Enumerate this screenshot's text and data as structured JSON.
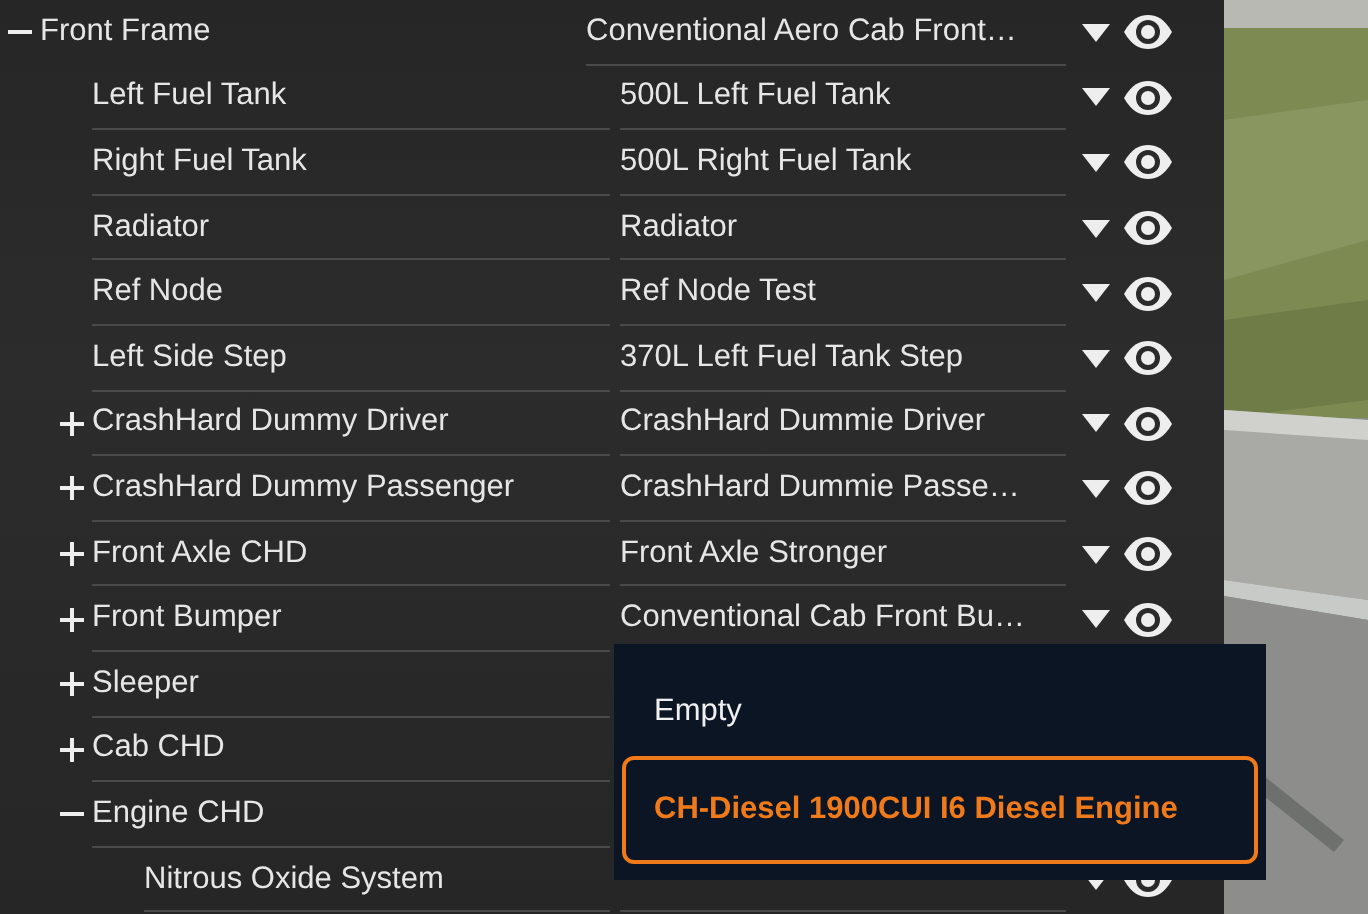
{
  "tree": [
    {
      "label": "Front Frame",
      "value": "Conventional Aero Cab Front…",
      "expanded": true,
      "children": [
        {
          "label": "Left Fuel Tank",
          "value": "500L Left Fuel Tank"
        },
        {
          "label": "Right Fuel Tank",
          "value": "500L Right Fuel Tank"
        },
        {
          "label": "Radiator",
          "value": "Radiator"
        },
        {
          "label": "Ref Node",
          "value": "Ref Node Test"
        },
        {
          "label": "Left Side Step",
          "value": "370L Left Fuel Tank Step"
        },
        {
          "label": "CrashHard Dummy Driver",
          "value": "CrashHard Dummie Driver",
          "expanded": false
        },
        {
          "label": "CrashHard Dummy Passenger",
          "value": "CrashHard Dummie Passe…",
          "expanded": false
        },
        {
          "label": "Front Axle CHD",
          "value": "Front Axle Stronger",
          "expanded": false
        },
        {
          "label": "Front Bumper",
          "value": "Conventional Cab Front Bu…",
          "expanded": false
        },
        {
          "label": "Sleeper",
          "expanded": false
        },
        {
          "label": "Cab CHD",
          "expanded": false
        },
        {
          "label": "Engine CHD",
          "expanded": true,
          "children": [
            {
              "label": "Nitrous Oxide System"
            }
          ]
        }
      ]
    }
  ],
  "dropdown": {
    "options": [
      {
        "label": "Empty",
        "selected": false
      },
      {
        "label": "CH-Diesel 1900CUI I6 Diesel Engine",
        "selected": true
      }
    ]
  }
}
